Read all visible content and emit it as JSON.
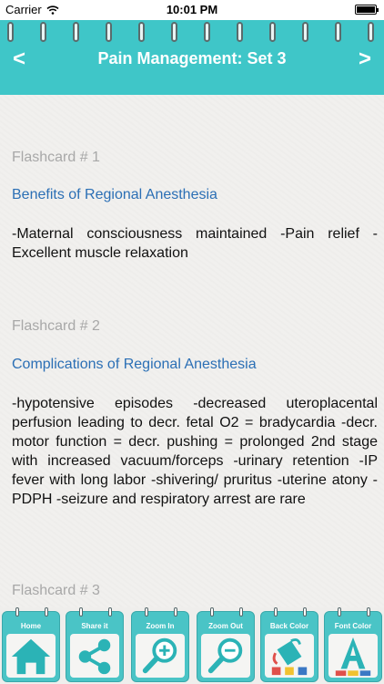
{
  "status_bar": {
    "carrier": "Carrier",
    "time": "10:01 PM"
  },
  "header": {
    "prev_label": "<",
    "title": "Pain Management: Set 3",
    "next_label": ">"
  },
  "cards": [
    {
      "number": "Flashcard # 1",
      "title": "Benefits of Regional Anesthesia",
      "body": "-Maternal consciousness maintained -Pain relief -Excellent muscle relaxation"
    },
    {
      "number": "Flashcard # 2",
      "title": "Complications of Regional Anesthesia",
      "body": "-hypotensive episodes -decreased uteroplacental perfusion leading to decr. fetal O2 = bradycardia -decr. motor function = decr. pushing = prolonged 2nd stage with increased vacuum/forceps -urinary retention -IP fever with long labor -shivering/ pruritus -uterine atony -PDPH -seizure and respiratory arrest are rare"
    },
    {
      "number": "Flashcard # 3"
    }
  ],
  "toolbar": {
    "home_label": "Home",
    "share_label": "Share it",
    "zoom_in_label": "Zoom In",
    "zoom_out_label": "Zoom Out",
    "back_color_label": "Back Color",
    "font_color_label": "Font Color"
  },
  "colors": {
    "header": "#3fc6c8",
    "title_text": "#2b6fb5",
    "number_text": "#a8a8a8",
    "toolbar_button": "#4ac4c6"
  }
}
